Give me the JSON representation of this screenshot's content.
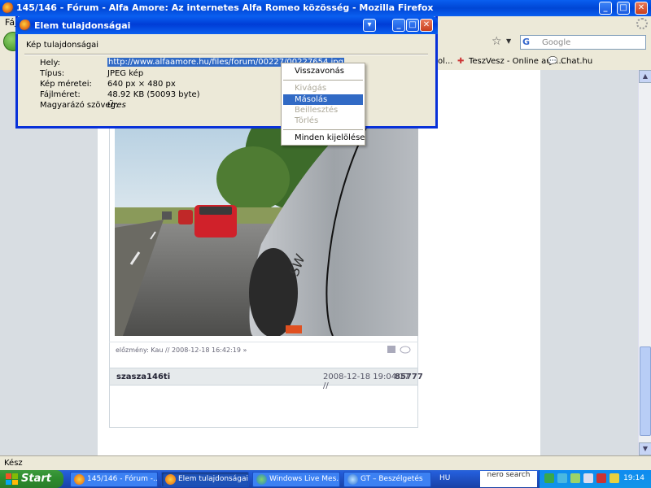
{
  "window": {
    "title": "145/146 - Fórum - Alfa Amore: Az internetes Alfa Romeo közösség - Mozilla Firefox",
    "menubar_first": "Fájl"
  },
  "search": {
    "engine_letter": "G",
    "placeholder": "Google"
  },
  "bookmarks": [
    {
      "label": "ol..."
    },
    {
      "label": "TeszVesz - Online auk..."
    },
    {
      "label": "Chat.hu"
    }
  ],
  "dialog": {
    "title": "Elem tulajdonságai",
    "heading": "Kép tulajdonságai",
    "properties": [
      {
        "label": "Hely:",
        "value": "http://www.alfaamore.hu/files/forum/00227/00227654.jpg"
      },
      {
        "label": "Típus:",
        "value": "JPEG kép"
      },
      {
        "label": "Kép méretei:",
        "value": "640 px × 480 px"
      },
      {
        "label": "Fájlméret:",
        "value": "48.92 KB (50093 byte)"
      },
      {
        "label": "Magyarázó szöveg:",
        "value": "Üres"
      }
    ]
  },
  "context_menu": {
    "items": [
      {
        "label": "Visszavonás",
        "enabled": true,
        "highlighted": false
      },
      {
        "label": "Kivágás",
        "enabled": false,
        "highlighted": false
      },
      {
        "label": "Másolás",
        "enabled": true,
        "highlighted": true
      },
      {
        "label": "Beillesztés",
        "enabled": false,
        "highlighted": false
      },
      {
        "label": "Törlés",
        "enabled": false,
        "highlighted": false
      },
      {
        "label": "Minden kijelölése",
        "enabled": true,
        "highlighted": false
      }
    ]
  },
  "post": {
    "footer": "előzmény: Kau // 2008-12-18 16:42:19 »"
  },
  "post2": {
    "username": "szasza146ti",
    "date": "2008-12-18 19:04:17 //",
    "number": "85777"
  },
  "statusbar": {
    "text": "Kész"
  },
  "taskbar": {
    "start_label": "Start",
    "tasks": [
      {
        "label": "145/146 - Fórum -...",
        "active": false
      },
      {
        "label": "Elem tulajdonságai",
        "active": true
      },
      {
        "label": "Windows Live Mes...",
        "active": false
      },
      {
        "label": "GT – Beszélgetés",
        "active": false
      }
    ],
    "language": "HU",
    "nero_label": "nero search",
    "clock": "19:14"
  },
  "colors": {
    "xp_blue": "#0a5ff0",
    "selection": "#316ac5",
    "taskbar": "#245edb"
  }
}
